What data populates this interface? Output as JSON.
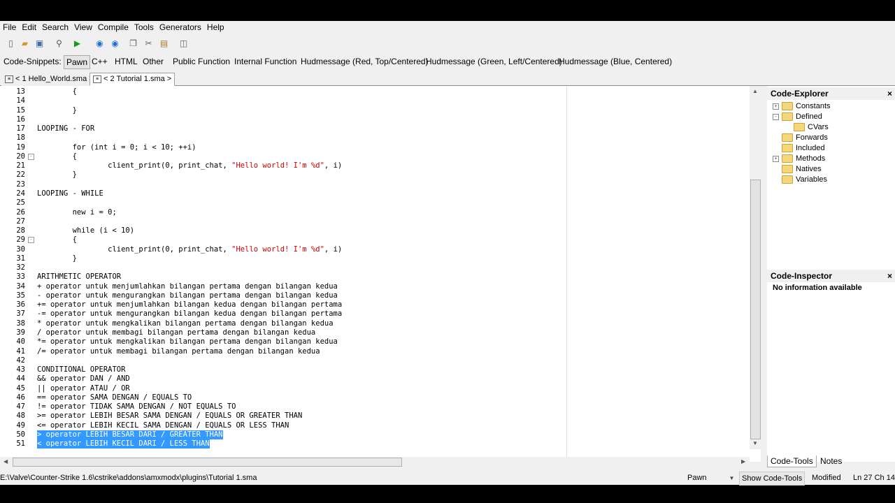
{
  "menu": [
    "File",
    "Edit",
    "Search",
    "View",
    "Compile",
    "Tools",
    "Generators",
    "Help"
  ],
  "toolbar_icons": [
    "new-file-icon",
    "open-file-icon",
    "save-icon",
    "find-icon",
    "compile-run-icon",
    "web-icon",
    "globe-icon",
    "copy-icon",
    "cut-icon",
    "paste-icon",
    "script-icon"
  ],
  "snippets": {
    "label": "Code-Snippets:",
    "items": [
      "Pawn",
      "C++",
      "HTML",
      "Other",
      "Public Function",
      "Internal Function",
      "Hudmessage (Red, Top/Centered)",
      "Hudmessage (Green, Left/Centered)",
      "Hudmessage (Blue, Centered)"
    ],
    "active": "Pawn"
  },
  "doc_tabs": [
    {
      "label": "< 1 Hello_World.sma >",
      "active": false
    },
    {
      "label": "< 2 Tutorial 1.sma >",
      "active": true
    }
  ],
  "code_lines": [
    {
      "n": "13",
      "t": "        {"
    },
    {
      "n": "14",
      "t": ""
    },
    {
      "n": "15",
      "t": "        }"
    },
    {
      "n": "16",
      "t": ""
    },
    {
      "n": "17",
      "t": "LOOPING - FOR"
    },
    {
      "n": "18",
      "t": ""
    },
    {
      "n": "19",
      "t": "        for (int i = 0; i < 10; ++i)"
    },
    {
      "n": "20",
      "t": "        {",
      "fold": "-"
    },
    {
      "n": "21",
      "t": "                client_print(0, print_chat, \"Hello world! I'm %d\", i)"
    },
    {
      "n": "22",
      "t": "        }"
    },
    {
      "n": "23",
      "t": ""
    },
    {
      "n": "24",
      "t": "LOOPING - WHILE"
    },
    {
      "n": "25",
      "t": ""
    },
    {
      "n": "26",
      "t": "        new i = 0;"
    },
    {
      "n": "27",
      "t": ""
    },
    {
      "n": "28",
      "t": "        while (i < 10)"
    },
    {
      "n": "29",
      "t": "        {",
      "fold": "-"
    },
    {
      "n": "30",
      "t": "                client_print(0, print_chat, \"Hello world! I'm %d\", i)"
    },
    {
      "n": "31",
      "t": "        }"
    },
    {
      "n": "32",
      "t": ""
    },
    {
      "n": "33",
      "t": "ARITHMETIC OPERATOR"
    },
    {
      "n": "34",
      "t": "+ operator untuk menjumlahkan bilangan pertama dengan bilangan kedua"
    },
    {
      "n": "35",
      "t": "- operator untuk mengurangkan bilangan pertama dengan bilangan kedua"
    },
    {
      "n": "36",
      "t": "+= operator untuk menjumlahkan bilangan kedua dengan bilangan pertama"
    },
    {
      "n": "37",
      "t": "-= operator untuk mengurangkan bilangan kedua dengan bilangan pertama"
    },
    {
      "n": "38",
      "t": "* operator untuk mengkalikan bilangan pertama dengan bilangan kedua"
    },
    {
      "n": "39",
      "t": "/ operator untuk membagi bilangan pertama dengan bilangan kedua"
    },
    {
      "n": "40",
      "t": "*= operator untuk mengkalikan bilangan pertama dengan bilangan kedua"
    },
    {
      "n": "41",
      "t": "/= operator untuk membagi bilangan pertama dengan bilangan kedua"
    },
    {
      "n": "42",
      "t": ""
    },
    {
      "n": "43",
      "t": "CONDITIONAL OPERATOR"
    },
    {
      "n": "44",
      "t": "&& operator DAN / AND"
    },
    {
      "n": "45",
      "t": "|| operator ATAU / OR"
    },
    {
      "n": "46",
      "t": "== operator SAMA DENGAN / EQUALS TO"
    },
    {
      "n": "47",
      "t": "!= operator TIDAK SAMA DENGAN / NOT EQUALS TO"
    },
    {
      "n": "48",
      "t": ">= operator LEBIH BESAR SAMA DENGAN / EQUALS OR GREATER THAN"
    },
    {
      "n": "49",
      "t": "<= operator LEBIH KECIL SAMA DENGAN / EQUALS OR LESS THAN"
    },
    {
      "n": "50",
      "t": "> operator LEBIH BESAR DARI / GREATER THAN",
      "sel": true
    },
    {
      "n": "51",
      "t": "< operator LEBIH KECIL DARI / LESS THAN",
      "sel": true
    }
  ],
  "code_explorer": {
    "title": "Code-Explorer",
    "items": [
      {
        "label": "Constants",
        "expander": "+",
        "level": 0
      },
      {
        "label": "Defined",
        "expander": "-",
        "level": 0
      },
      {
        "label": "CVars",
        "expander": "",
        "level": 1
      },
      {
        "label": "Forwards",
        "expander": "",
        "level": 0
      },
      {
        "label": "Included",
        "expander": "",
        "level": 0
      },
      {
        "label": "Methods",
        "expander": "+",
        "level": 0
      },
      {
        "label": "Natives",
        "expander": "",
        "level": 0
      },
      {
        "label": "Variables",
        "expander": "",
        "level": 0
      }
    ]
  },
  "code_inspector": {
    "title": "Code-Inspector",
    "message": "No information available"
  },
  "side_tabs": [
    "Code-Tools",
    "Notes"
  ],
  "close_glyph": "×",
  "status": {
    "path": "E:\\Valve\\Counter-Strike 1.6\\cstrike\\addons\\amxmodx\\plugins\\Tutorial 1.sma",
    "language": "Pawn",
    "show_code_tools": "Show Code-Tools",
    "modified": "Modified",
    "position": "Ln 27 Ch 14"
  },
  "colors": {
    "selection": "#3399ff",
    "string": "#cc0000",
    "comment": "#008000"
  }
}
